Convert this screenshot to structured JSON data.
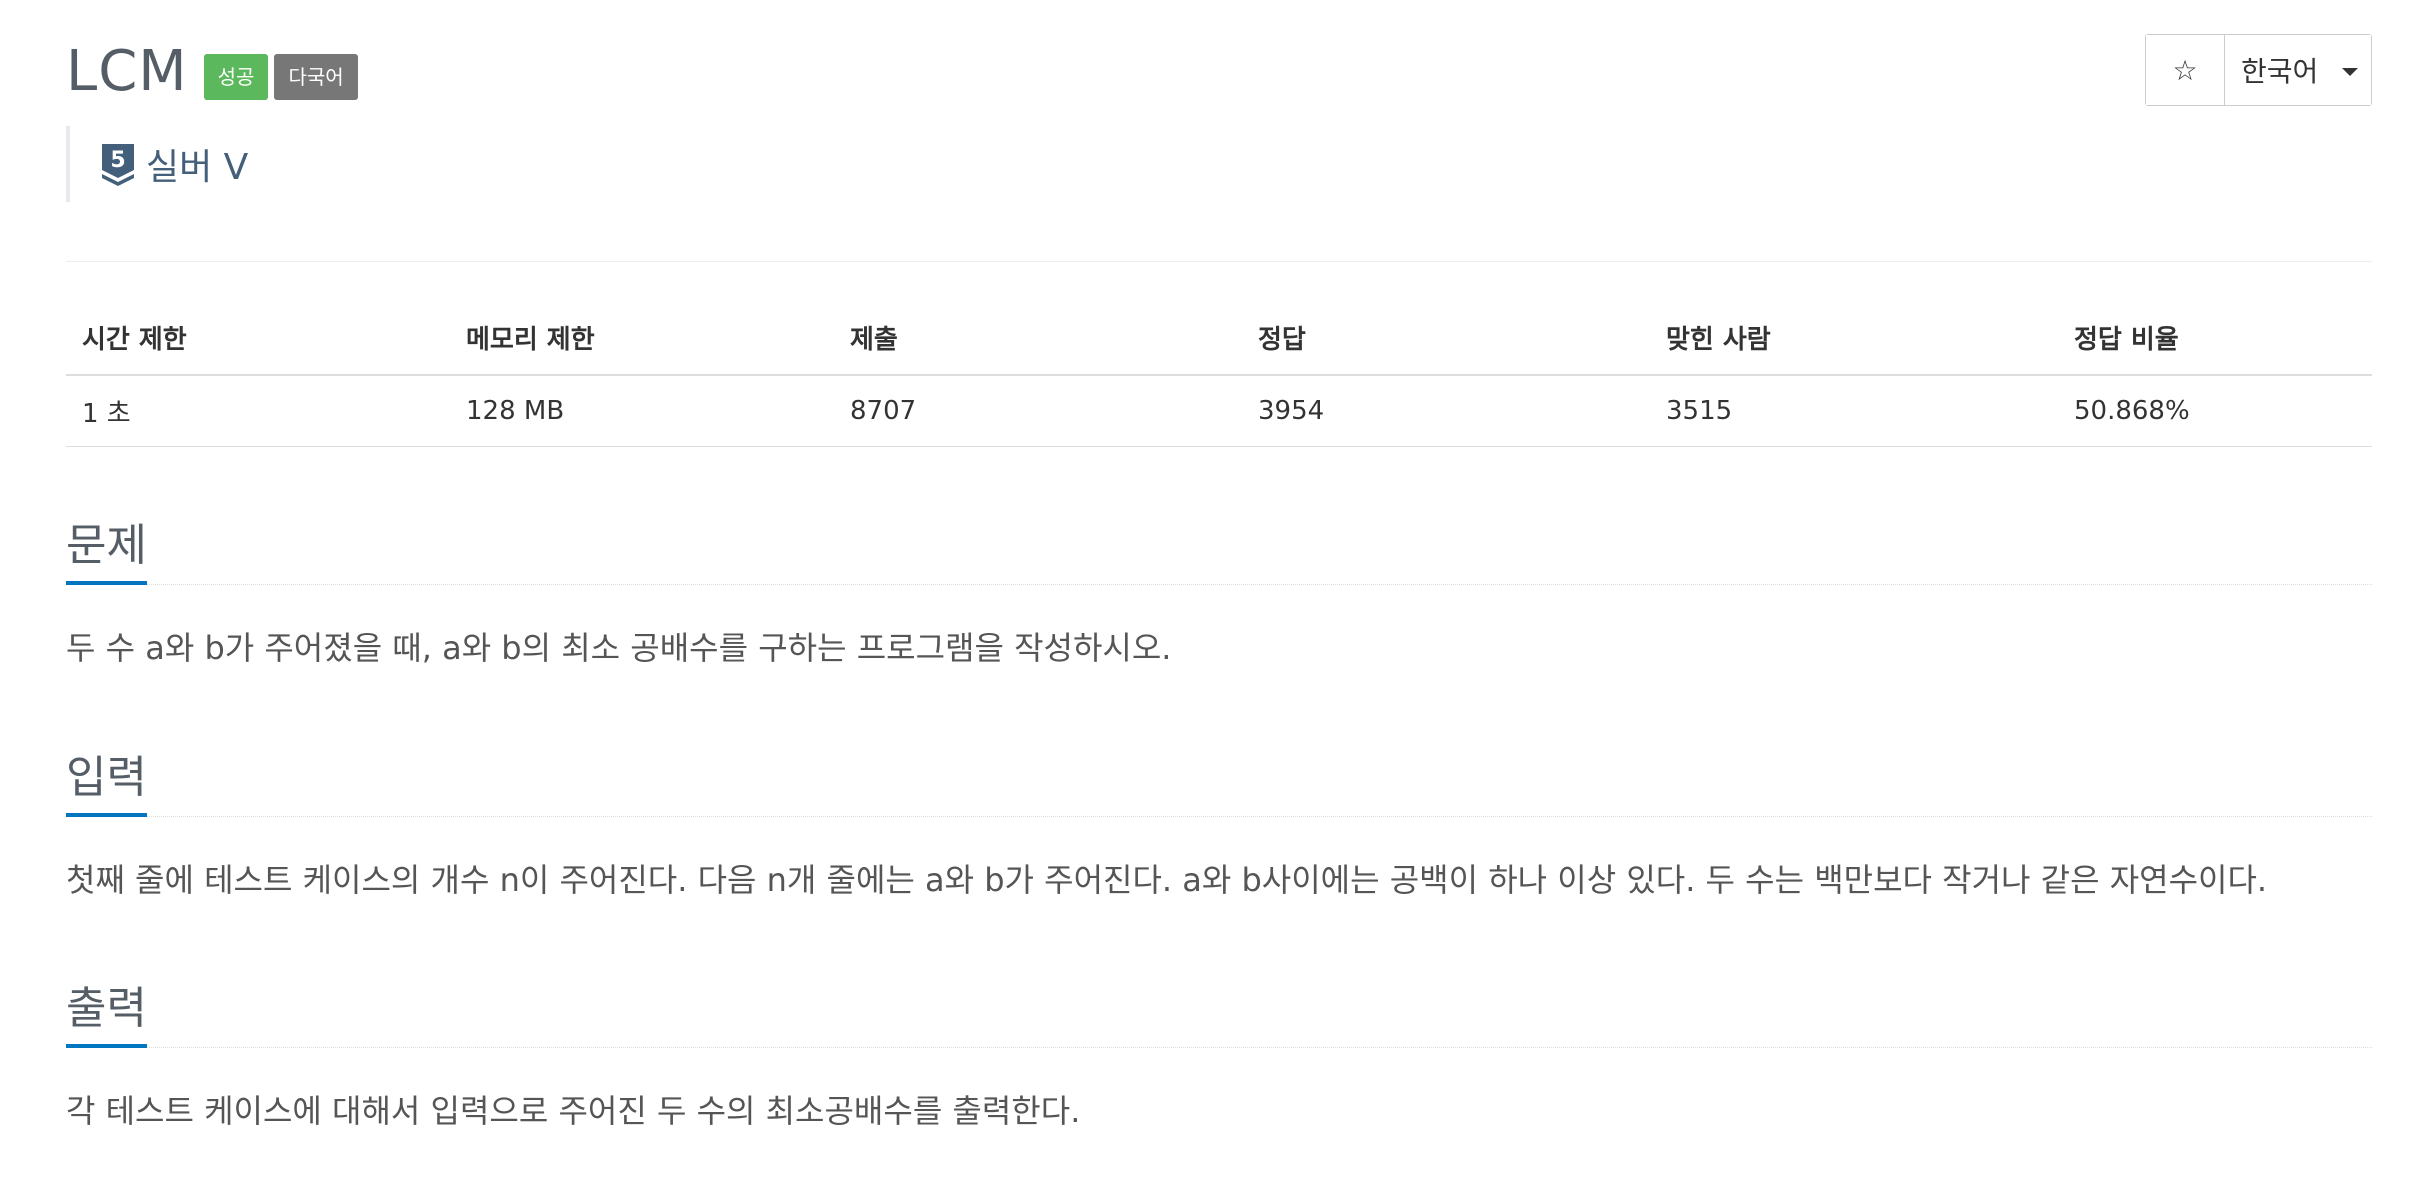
{
  "header": {
    "title": "LCM",
    "badges": {
      "success": "성공",
      "language": "다국어"
    },
    "tier": "실버 V",
    "tier_level": "5"
  },
  "controls": {
    "star_label": "☆",
    "language_label": "한국어"
  },
  "info_table": {
    "headers": [
      "시간 제한",
      "메모리 제한",
      "제출",
      "정답",
      "맞힌 사람",
      "정답 비율"
    ],
    "values": [
      "1 초",
      "128 MB",
      "8707",
      "3954",
      "3515",
      "50.868%"
    ]
  },
  "sections": {
    "problem": {
      "title": "문제",
      "body": "두 수 a와 b가 주어졌을 때, a와 b의 최소 공배수를 구하는 프로그램을 작성하시오."
    },
    "input": {
      "title": "입력",
      "body": "첫째 줄에 테스트 케이스의 개수 n이 주어진다. 다음 n개 줄에는 a와 b가 주어진다. a와 b사이에는 공백이 하나 이상 있다. 두 수는 백만보다 작거나 같은 자연수이다."
    },
    "output": {
      "title": "출력",
      "body": "각 테스트 케이스에 대해서 입력으로 주어진 두 수의 최소공배수를 출력한다."
    }
  },
  "colors": {
    "success_badge": "#5cb85c",
    "language_badge": "#777777",
    "section_underline": "#0076c0",
    "tier_color": "#435f7a"
  }
}
